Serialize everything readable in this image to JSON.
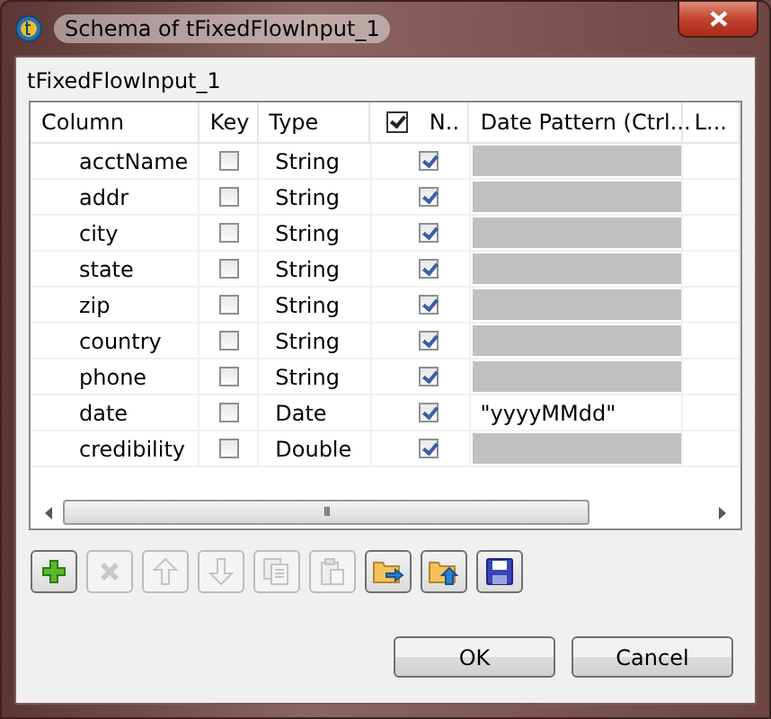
{
  "window": {
    "title": "Schema of tFixedFlowInput_1"
  },
  "group_label": "tFixedFlowInput_1",
  "table": {
    "columns": [
      {
        "kind": "text",
        "label": "Column"
      },
      {
        "kind": "text",
        "label": "Key"
      },
      {
        "kind": "text",
        "label": "Type"
      },
      {
        "kind": "check",
        "label": "N..",
        "checked": true
      },
      {
        "kind": "text",
        "label": "Date Pattern (Ctrl..."
      },
      {
        "kind": "text",
        "label": "L..."
      }
    ],
    "rows": [
      {
        "column": "acctName",
        "key": false,
        "type": "String",
        "nullable": true,
        "date_pattern_enabled": false
      },
      {
        "column": "addr",
        "key": false,
        "type": "String",
        "nullable": true,
        "date_pattern_enabled": false
      },
      {
        "column": "city",
        "key": false,
        "type": "String",
        "nullable": true,
        "date_pattern_enabled": false
      },
      {
        "column": "state",
        "key": false,
        "type": "String",
        "nullable": true,
        "date_pattern_enabled": false
      },
      {
        "column": "zip",
        "key": false,
        "type": "String",
        "nullable": true,
        "date_pattern_enabled": false
      },
      {
        "column": "country",
        "key": false,
        "type": "String",
        "nullable": true,
        "date_pattern_enabled": false
      },
      {
        "column": "phone",
        "key": false,
        "type": "String",
        "nullable": true,
        "date_pattern_enabled": false
      },
      {
        "column": "date",
        "key": false,
        "type": "Date",
        "nullable": true,
        "date_pattern_enabled": true,
        "date_pattern": "\"yyyyMMdd\""
      },
      {
        "column": "credibility",
        "key": false,
        "type": "Double",
        "nullable": true,
        "date_pattern_enabled": false
      }
    ],
    "scrollbar_grip": "III"
  },
  "toolbar": [
    {
      "kind": "add",
      "disabled": false
    },
    {
      "kind": "remove",
      "disabled": true
    },
    {
      "kind": "up",
      "disabled": true
    },
    {
      "kind": "down",
      "disabled": true
    },
    {
      "kind": "copy",
      "disabled": true
    },
    {
      "kind": "paste",
      "disabled": true
    },
    {
      "kind": "import",
      "disabled": false
    },
    {
      "kind": "export",
      "disabled": false
    },
    {
      "kind": "save",
      "disabled": false
    }
  ],
  "buttons": [
    {
      "label": "OK"
    },
    {
      "label": "Cancel"
    }
  ]
}
